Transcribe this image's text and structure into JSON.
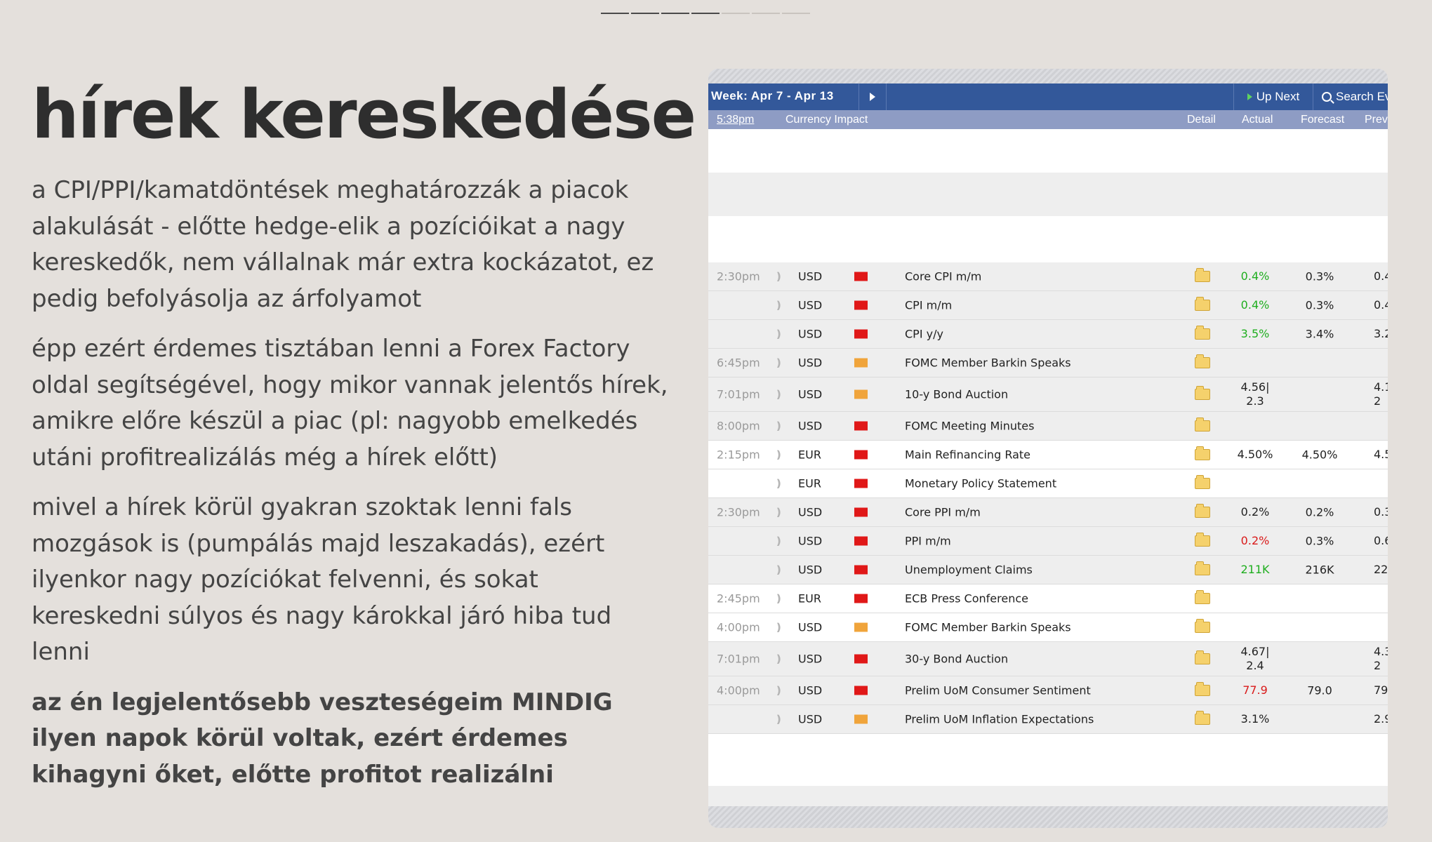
{
  "progress": {
    "total_steps": 7,
    "completed_steps": 4
  },
  "slide": {
    "title": "hírek kereskedése",
    "paragraphs": [
      "a CPI/PPI/kamatdöntések meghatározzák a piacok alakulását - előtte hedge-elik a pozícióikat a nagy kereskedők, nem vállalnak már extra kockázatot, ez pedig befolyásolja az árfolyamot",
      "épp ezért érdemes tisztában lenni a Forex Factory oldal segítségével, hogy mikor vannak jelentős hírek, amikre előre készül a piac (pl: nagyobb emelkedés utáni profitrealizálás még a hírek előtt)",
      "mivel a hírek körül gyakran szoktak lenni fals mozgások is (pumpálás majd leszakadás), ezért ilyenkor nagy pozíciókat felvenni, és sokat kereskedni súlyos és nagy károkkal járó hiba tud lenni",
      "az én legjelentősebb veszteségeim MINDIG ilyen napok körül voltak, ezért érdemes kihagyni őket, előtte profitot realizálni"
    ]
  },
  "calendar": {
    "week_label": "Week: Apr 7 - Apr 13",
    "up_next_label": "Up Next",
    "search_label": "Search Ev",
    "columns": {
      "time": "5:38pm",
      "currency_impact": "Currency Impact",
      "detail": "Detail",
      "actual": "Actual",
      "forecast": "Forecast",
      "previous": "Prev"
    },
    "rows": [
      {
        "time": "2:30pm",
        "currency": "USD",
        "impact": "red",
        "event": "Core CPI m/m",
        "actual": "0.4%",
        "actual_color": "green",
        "forecast": "0.3%",
        "previous": "0.4"
      },
      {
        "time": "",
        "currency": "USD",
        "impact": "red",
        "event": "CPI m/m",
        "actual": "0.4%",
        "actual_color": "green",
        "forecast": "0.3%",
        "previous": "0.4"
      },
      {
        "time": "",
        "currency": "USD",
        "impact": "red",
        "event": "CPI y/y",
        "actual": "3.5%",
        "actual_color": "green",
        "forecast": "3.4%",
        "previous": "3.2"
      },
      {
        "time": "6:45pm",
        "currency": "USD",
        "impact": "orange",
        "event": "FOMC Member Barkin Speaks",
        "actual": "",
        "actual_color": "",
        "forecast": "",
        "previous": ""
      },
      {
        "time": "7:01pm",
        "currency": "USD",
        "impact": "orange",
        "event": "10-y Bond Auction",
        "actual": "4.56|\n2.3",
        "actual_color": "",
        "forecast": "",
        "previous": "4.1\n2"
      },
      {
        "time": "8:00pm",
        "currency": "USD",
        "impact": "red",
        "event": "FOMC Meeting Minutes",
        "actual": "",
        "actual_color": "",
        "forecast": "",
        "previous": ""
      },
      {
        "time": "2:15pm",
        "currency": "EUR",
        "impact": "red",
        "event": "Main Refinancing Rate",
        "actual": "4.50%",
        "actual_color": "",
        "forecast": "4.50%",
        "previous": "4.5"
      },
      {
        "time": "",
        "currency": "EUR",
        "impact": "red",
        "event": "Monetary Policy Statement",
        "actual": "",
        "actual_color": "",
        "forecast": "",
        "previous": ""
      },
      {
        "time": "2:30pm",
        "currency": "USD",
        "impact": "red",
        "event": "Core PPI m/m",
        "actual": "0.2%",
        "actual_color": "",
        "forecast": "0.2%",
        "previous": "0.3"
      },
      {
        "time": "",
        "currency": "USD",
        "impact": "red",
        "event": "PPI m/m",
        "actual": "0.2%",
        "actual_color": "red",
        "forecast": "0.3%",
        "previous": "0.6"
      },
      {
        "time": "",
        "currency": "USD",
        "impact": "red",
        "event": "Unemployment Claims",
        "actual": "211K",
        "actual_color": "green",
        "forecast": "216K",
        "previous": "22"
      },
      {
        "time": "2:45pm",
        "currency": "EUR",
        "impact": "red",
        "event": "ECB Press Conference",
        "actual": "",
        "actual_color": "",
        "forecast": "",
        "previous": ""
      },
      {
        "time": "4:00pm",
        "currency": "USD",
        "impact": "orange",
        "event": "FOMC Member Barkin Speaks",
        "actual": "",
        "actual_color": "",
        "forecast": "",
        "previous": ""
      },
      {
        "time": "7:01pm",
        "currency": "USD",
        "impact": "red",
        "event": "30-y Bond Auction",
        "actual": "4.67|\n2.4",
        "actual_color": "",
        "forecast": "",
        "previous": "4.3\n2"
      },
      {
        "time": "4:00pm",
        "currency": "USD",
        "impact": "red",
        "event": "Prelim UoM Consumer Sentiment",
        "actual": "77.9",
        "actual_color": "red",
        "forecast": "79.0",
        "previous": "79"
      },
      {
        "time": "",
        "currency": "USD",
        "impact": "orange",
        "event": "Prelim UoM Inflation Expectations",
        "actual": "3.1%",
        "actual_color": "",
        "forecast": "",
        "previous": "2.9"
      }
    ]
  }
}
